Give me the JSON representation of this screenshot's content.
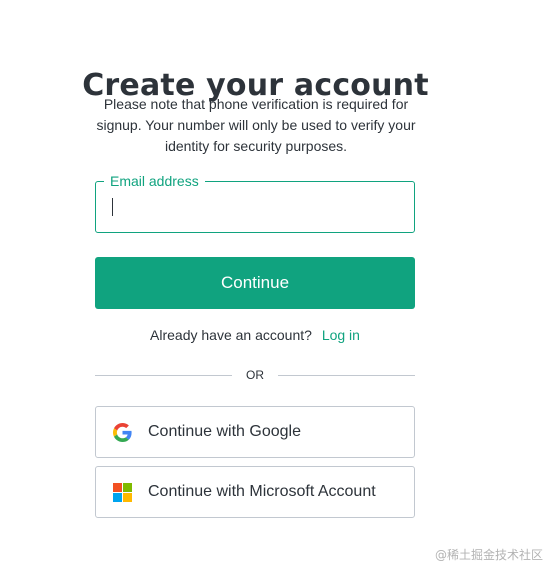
{
  "title": "Create your account",
  "subtitle": "Please note that phone verification is required for signup. Your number will only be used to verify your identity for security purposes.",
  "email": {
    "label": "Email address",
    "value": "",
    "placeholder": ""
  },
  "continue_label": "Continue",
  "login_prompt": {
    "text": "Already have an account?",
    "link": "Log in"
  },
  "divider_text": "OR",
  "social": {
    "google": {
      "label": "Continue with Google",
      "icon": "google-icon"
    },
    "microsoft": {
      "label": "Continue with Microsoft Account",
      "icon": "microsoft-icon"
    }
  },
  "watermark": "@稀土掘金技术社区",
  "colors": {
    "accent": "#10a37f",
    "text": "#2d333a",
    "border": "#c2c8d0",
    "google_blue": "#4285F4",
    "google_red": "#EA4335",
    "google_yellow": "#FBBC05",
    "google_green": "#34A853",
    "ms_red": "#F25022",
    "ms_green": "#7FBA00",
    "ms_blue": "#00A4EF",
    "ms_yellow": "#FFB900"
  }
}
